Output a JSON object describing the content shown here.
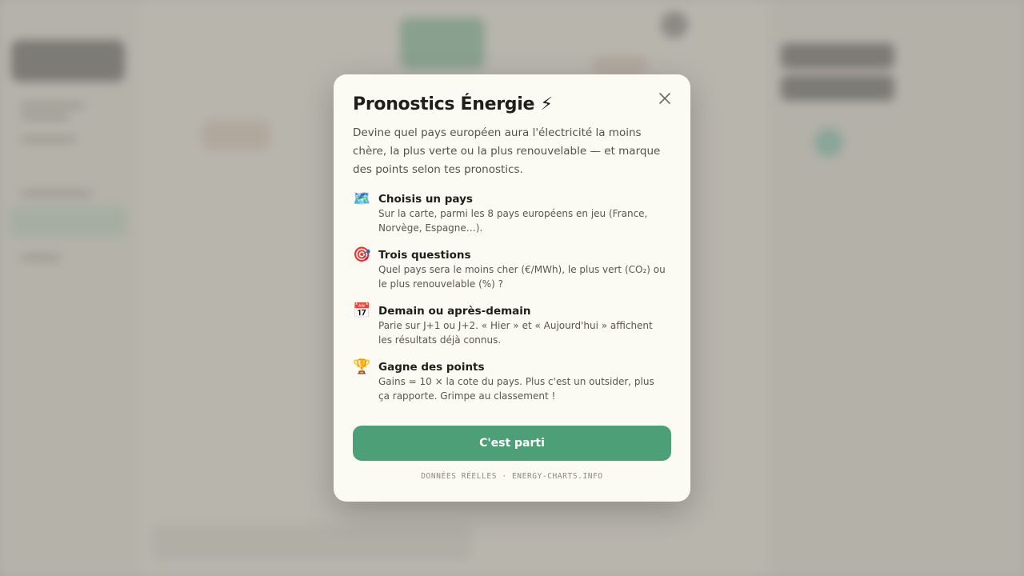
{
  "modal": {
    "title": "Pronostics Énergie ⚡",
    "close_icon": "close-icon",
    "intro": "Devine quel pays européen aura l'électricité la moins chère, la plus verte ou la plus renouvelable — et marque des points selon tes pronostics.",
    "steps": [
      {
        "icon": "🗺️",
        "icon_name": "map-icon",
        "title": "Choisis un pays",
        "desc": "Sur la carte, parmi les 8 pays européens en jeu (France, Norvège, Espagne…)."
      },
      {
        "icon": "🎯",
        "icon_name": "target-icon",
        "title": "Trois questions",
        "desc": "Quel pays sera le moins cher (€/MWh), le plus vert (CO₂) ou le plus renouvelable (%) ?"
      },
      {
        "icon": "📅",
        "icon_name": "calendar-icon",
        "title": "Demain ou après-demain",
        "desc": "Parie sur J+1 ou J+2. « Hier » et « Aujourd'hui » affichent les résultats déjà connus."
      },
      {
        "icon": "🏆",
        "icon_name": "trophy-icon",
        "title": "Gagne des points",
        "desc": "Gains = 10 × la cote du pays. Plus c'est un outsider, plus ça rapporte. Grimpe au classement !"
      }
    ],
    "cta_label": "C'est parti",
    "footer": "DONNÉES RÉELLES · ENERGY-CHARTS.INFO"
  },
  "colors": {
    "accent": "#4d9f78",
    "modal_bg": "#fbfaf3",
    "text": "#1f1e1b"
  }
}
